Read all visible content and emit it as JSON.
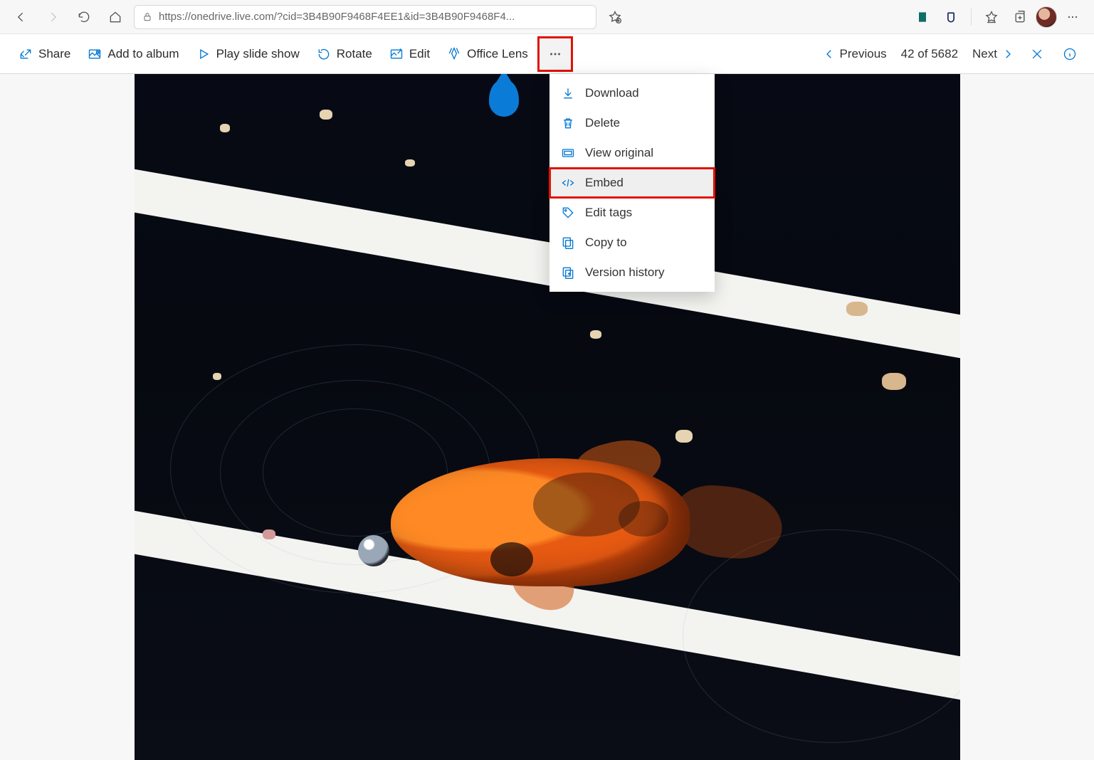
{
  "browser": {
    "url_display": "https://onedrive.live.com/?cid=3B4B90F9468F4EE1&id=3B4B90F9468F4...",
    "url_host": "onedrive.live.com"
  },
  "toolbar": {
    "share": "Share",
    "add_album": "Add to album",
    "slideshow": "Play slide show",
    "rotate": "Rotate",
    "edit": "Edit",
    "office_lens": "Office Lens"
  },
  "nav": {
    "previous": "Previous",
    "counter": "42 of 5682",
    "next": "Next"
  },
  "menu": {
    "download": "Download",
    "delete": "Delete",
    "view_original": "View original",
    "embed": "Embed",
    "edit_tags": "Edit tags",
    "copy_to": "Copy to",
    "version_history": "Version history"
  }
}
